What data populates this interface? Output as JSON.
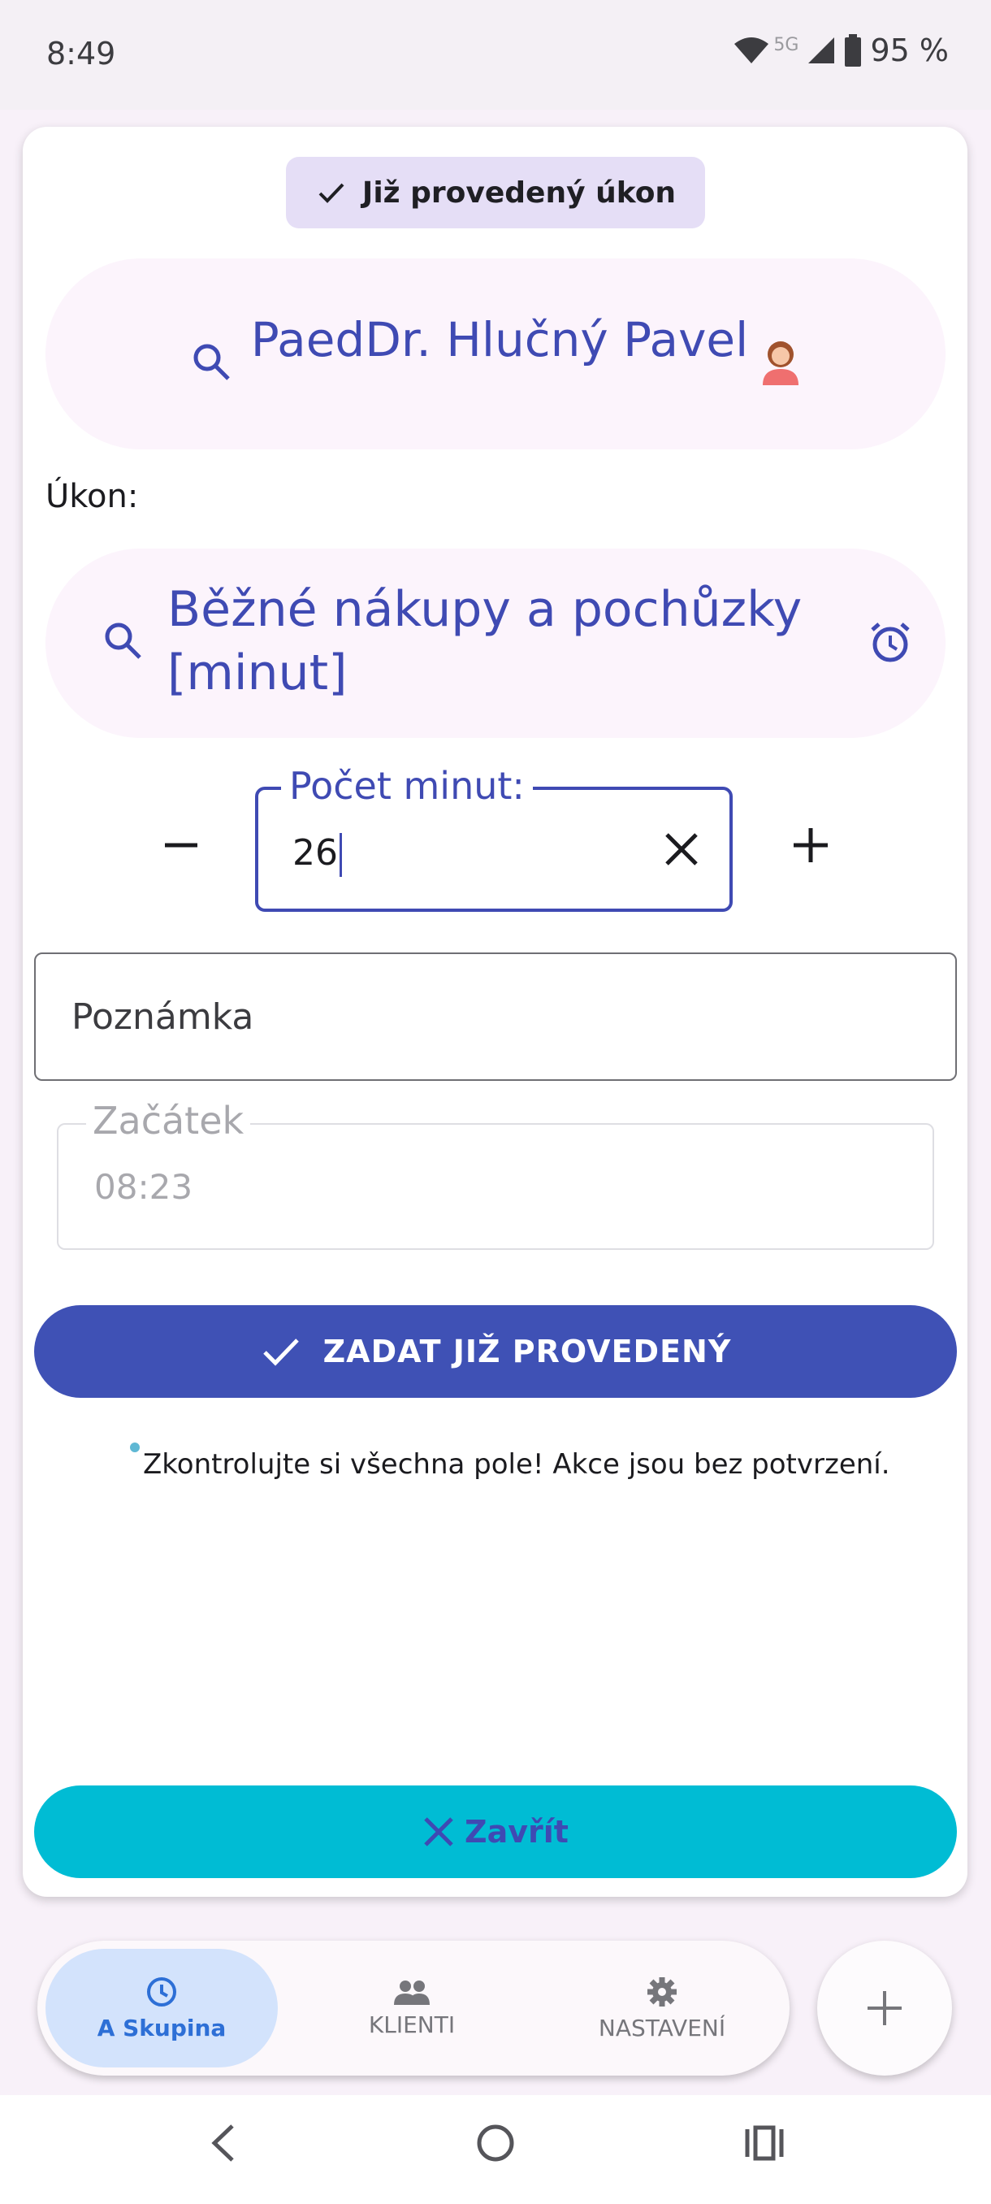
{
  "status_bar": {
    "time": "8:49",
    "network": "5G",
    "battery": "95 %"
  },
  "dialog": {
    "mode_chip": "Již provedený úkon",
    "client_name": "PaedDr. Hlučný Pavel",
    "task_label": "Úkon:",
    "task_name": "Běžné nákupy a pochůzky [minut]",
    "count_label": "Počet minut:",
    "count_value": "26",
    "note_placeholder": "Poznámka",
    "start_label": "Začátek",
    "start_value": "08:23",
    "submit_label": "ZADAT JIŽ PROVEDENÝ",
    "warning": "Zkontrolujte si všechna pole! Akce jsou bez potvrzení.",
    "close_label": "Zavřít"
  },
  "bottom_nav": {
    "items": [
      {
        "label": "A Skupina",
        "icon": "clock-icon",
        "active": true
      },
      {
        "label": "KLIENTI",
        "icon": "people-icon",
        "active": false
      },
      {
        "label": "NASTAVENÍ",
        "icon": "gear-icon",
        "active": false
      }
    ]
  },
  "colors": {
    "primary": "#3f51b5",
    "accent": "#00bcd4",
    "chip": "#e5def6",
    "pill": "#fcf4fc",
    "nav_active": "#d3e3fc"
  }
}
